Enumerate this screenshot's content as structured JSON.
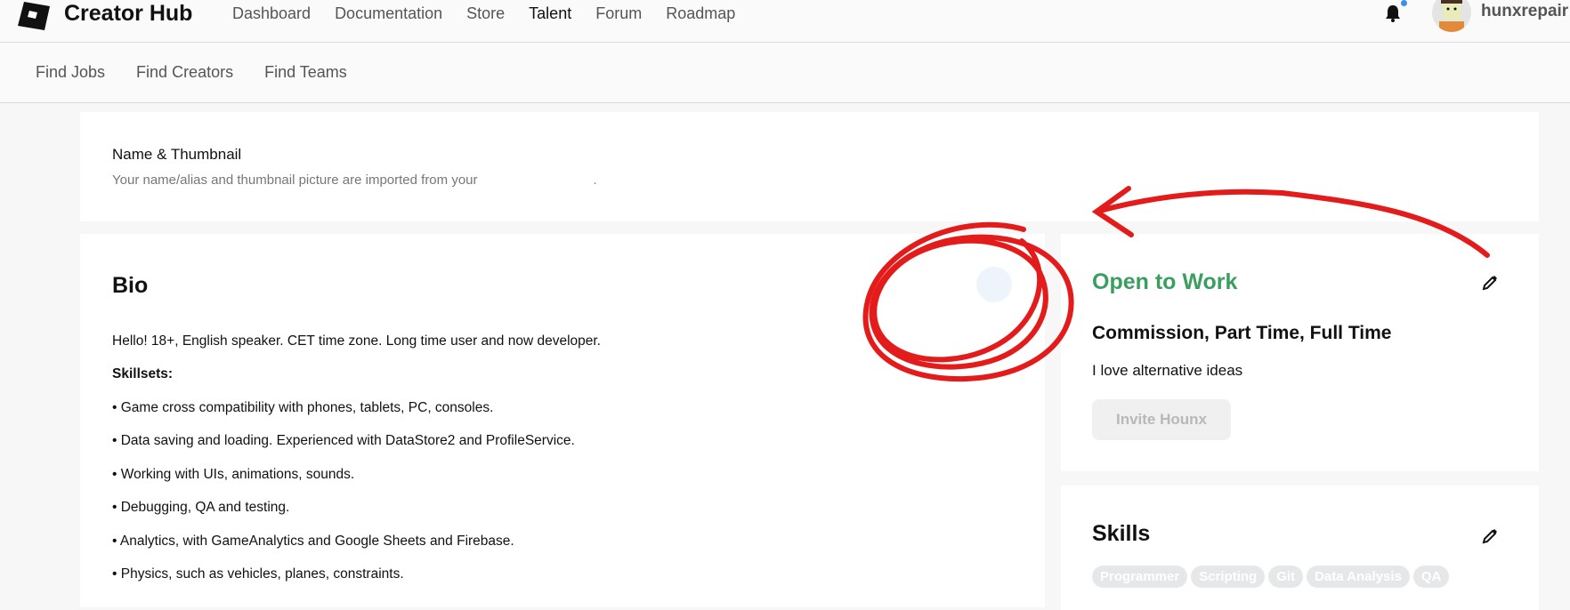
{
  "header": {
    "brand": "Creator Hub",
    "nav": [
      "Dashboard",
      "Documentation",
      "Store",
      "Talent",
      "Forum",
      "Roadmap"
    ],
    "active": "Talent",
    "username": "hunxrepair"
  },
  "subnav": [
    "Find Jobs",
    "Find Creators",
    "Find Teams"
  ],
  "name_card": {
    "title": "Name & Thumbnail",
    "desc": "Your name/alias and thumbnail picture are imported from your",
    "desc_end": "."
  },
  "bio": {
    "title": "Bio",
    "intro": "Hello! 18+, English speaker. CET time zone. Long time user and now developer.",
    "skillsets_label": "Skillsets:",
    "items": [
      "• Game cross compatibility with phones, tablets, PC, consoles.",
      "• Data saving and loading. Experienced with DataStore2 and ProfileService.",
      "• Working with UIs, animations, sounds.",
      "• Debugging, QA and testing.",
      "• Analytics, with GameAnalytics and Google Sheets and Firebase.",
      "• Physics, such as vehicles, planes, constraints."
    ]
  },
  "work": {
    "status": "Open to Work",
    "types": "Commission, Part Time, Full Time",
    "note": "I love alternative ideas",
    "invite_label": "Invite Hounx",
    "status_color": "#3a9e5f"
  },
  "skills": {
    "title": "Skills",
    "chips": [
      "Programmer",
      "Scripting",
      "Git",
      "Data Analysis",
      "QA"
    ]
  },
  "annotation_color": "#e31b1b"
}
